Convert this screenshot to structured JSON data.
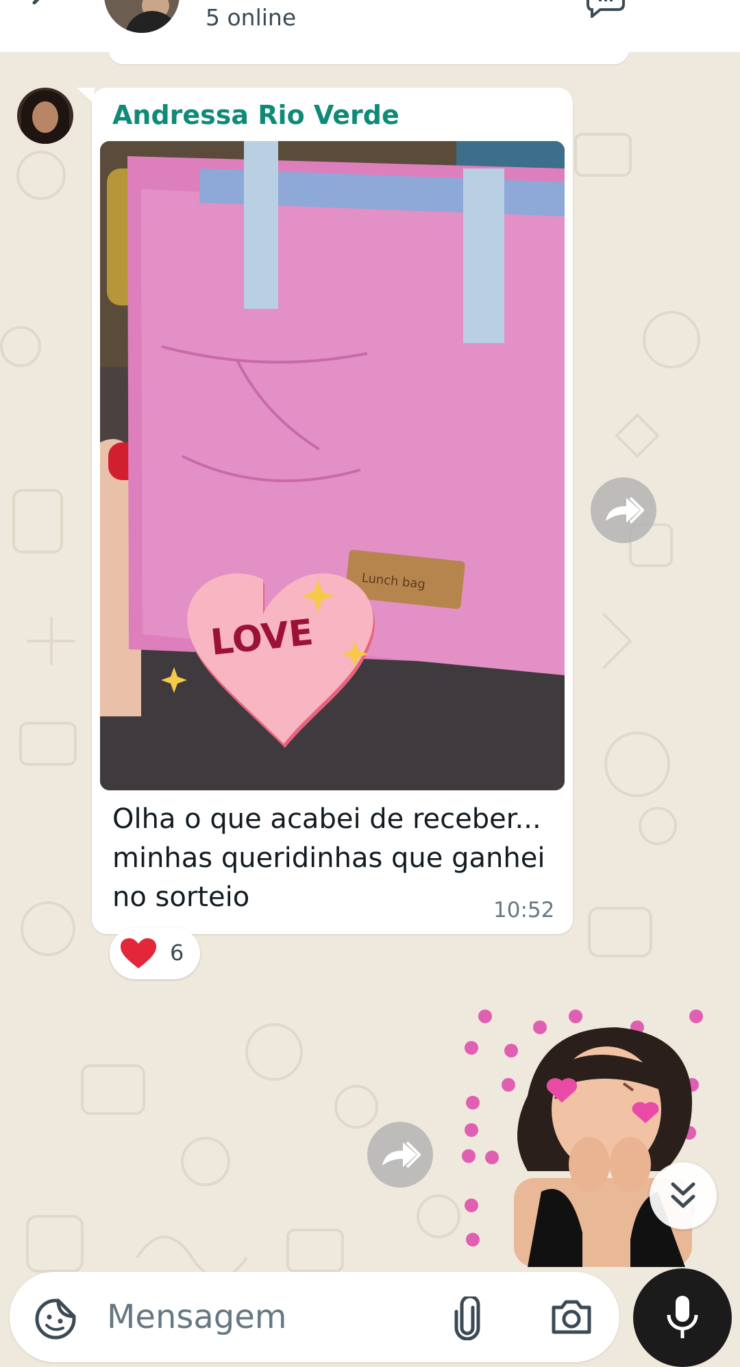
{
  "header": {
    "status_text": "5 online",
    "icons": [
      "back-arrow-icon",
      "group-avatar",
      "video-call-icon",
      "more-vertical-icon"
    ]
  },
  "message": {
    "sender_name": "Andressa Rio Verde",
    "caption": "Olha o que acabei de receber... minhas queridinhas que ganhei no sorteio",
    "time": "10:52",
    "photo_sticker_text": "LOVE",
    "reaction": {
      "emoji": "red-heart",
      "count": "6"
    }
  },
  "composer": {
    "placeholder": "Mensagem",
    "icons": [
      "sticker-icon",
      "paperclip-icon",
      "camera-icon",
      "microphone-icon"
    ]
  },
  "colors": {
    "sender_name": "#0f8a77",
    "wallpaper": "#efe9dd",
    "bubble": "#ffffff",
    "mic_button": "#1b1b1b"
  }
}
